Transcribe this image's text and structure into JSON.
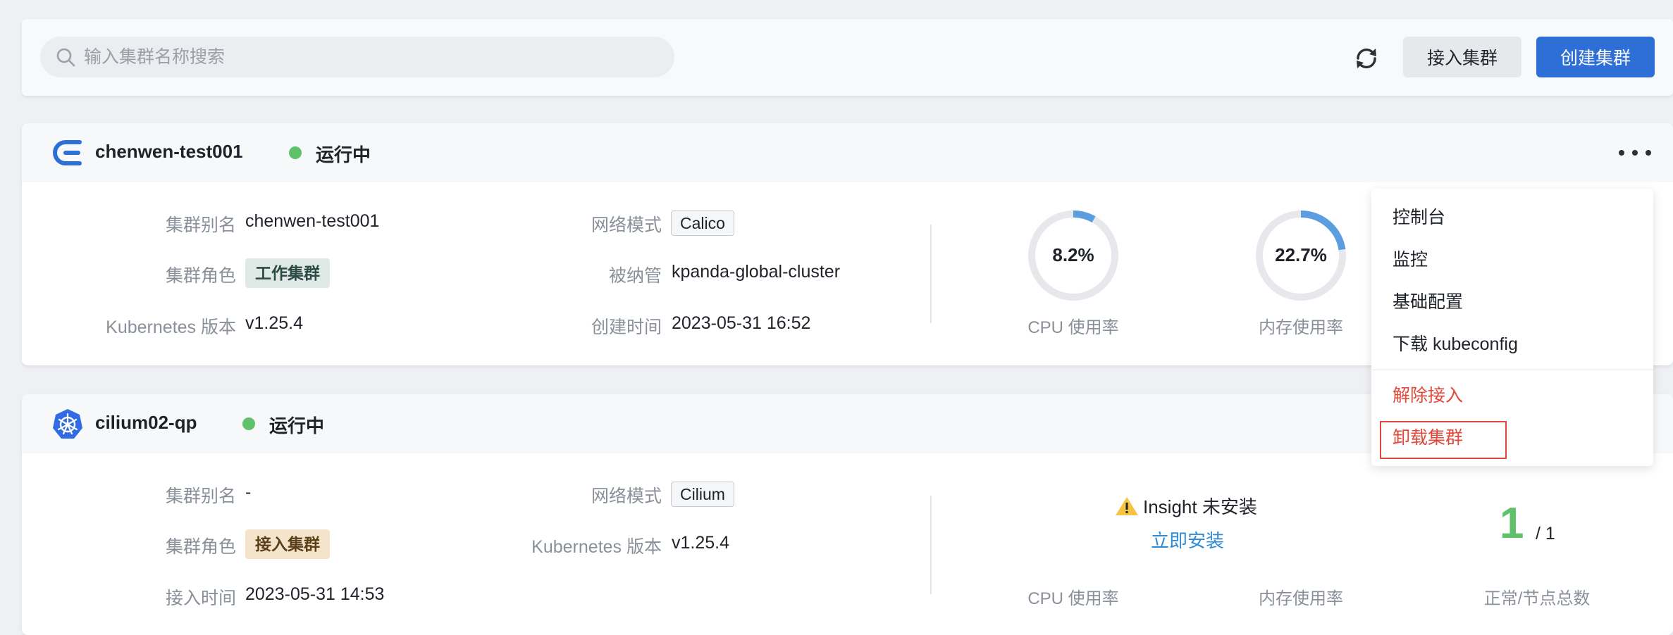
{
  "toolbar": {
    "search_placeholder": "输入集群名称搜索",
    "connect_button": "接入集群",
    "create_button": "创建集群"
  },
  "status_color": "#5fc26b",
  "accent_color": "#2d6fd6",
  "clusters": [
    {
      "name": "chenwen-test001",
      "status": "运行中",
      "logo_icon": "daocloud-logo-icon",
      "fields": {
        "alias_label": "集群别名",
        "alias": "chenwen-test001",
        "role_label": "集群角色",
        "role": "工作集群",
        "k8s_label": "Kubernetes 版本",
        "k8s": "v1.25.4",
        "network_label": "网络模式",
        "network": "Calico",
        "managed_label": "被纳管",
        "managed": "kpanda-global-cluster",
        "created_label": "创建时间",
        "created": "2023-05-31 16:52"
      },
      "metrics": {
        "cpu_value": "8.2%",
        "cpu_percent": 8.2,
        "cpu_label": "CPU 使用率",
        "mem_value": "22.7%",
        "mem_percent": 22.7,
        "mem_label": "内存使用率"
      }
    },
    {
      "name": "cilium02-qp",
      "status": "运行中",
      "logo_icon": "kubernetes-logo-icon",
      "fields": {
        "alias_label": "集群别名",
        "alias": "-",
        "role_label": "集群角色",
        "role": "接入集群",
        "joined_label": "接入时间",
        "joined": "2023-05-31 14:53",
        "network_label": "网络模式",
        "network": "Cilium",
        "k8s_label": "Kubernetes 版本",
        "k8s": "v1.25.4"
      },
      "insight": {
        "warning": "Insight 未安装",
        "install_link": "立即安装"
      },
      "metrics": {
        "cpu_label": "CPU 使用率",
        "mem_label": "内存使用率",
        "nodes_label": "正常/节点总数",
        "nodes_ready": "1",
        "nodes_total": "/ 1"
      }
    }
  ],
  "menu": {
    "items": [
      "控制台",
      "监控",
      "基础配置",
      "下载 kubeconfig"
    ],
    "danger_items": [
      "解除接入",
      "卸载集群"
    ]
  }
}
